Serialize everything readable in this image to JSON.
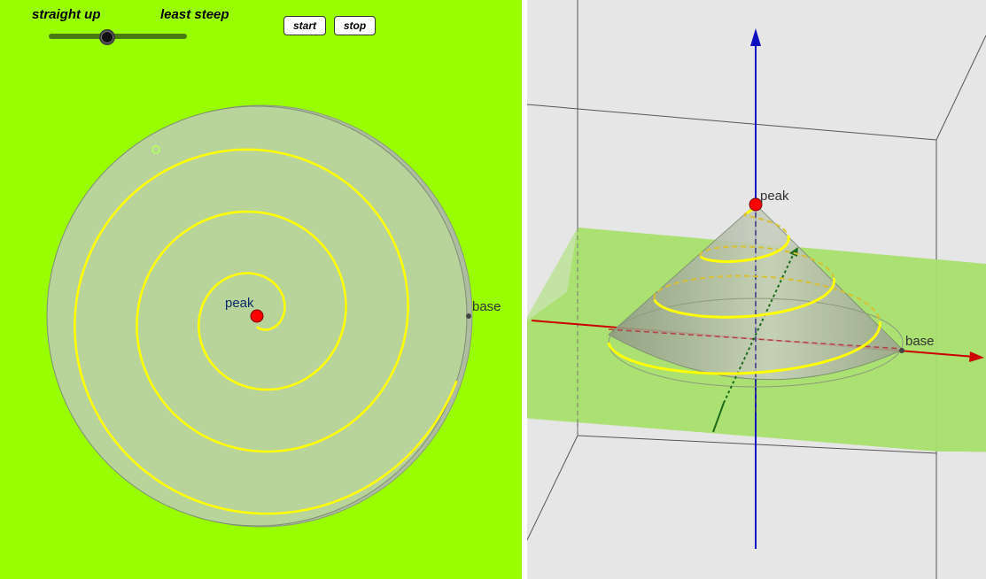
{
  "colors": {
    "background_2d": "#99ff00",
    "background_3d": "#e6e6e6",
    "disk": "#b8d49a",
    "spiral": "#ffff00",
    "peak_point": "#ff0000",
    "z_axis": "#1010c0",
    "x_axis": "#cc0000",
    "y_axis": "#1b6b1b",
    "plane": "#a6e06a"
  },
  "controls": {
    "slider_left_label": "straight up",
    "slider_right_label": "least steep",
    "slider_value_fraction": 0.42,
    "start_label": "start",
    "stop_label": "stop"
  },
  "view2d": {
    "peak_label": "peak",
    "base_label": "base"
  },
  "view3d": {
    "peak_label": "peak",
    "base_label": "base"
  }
}
